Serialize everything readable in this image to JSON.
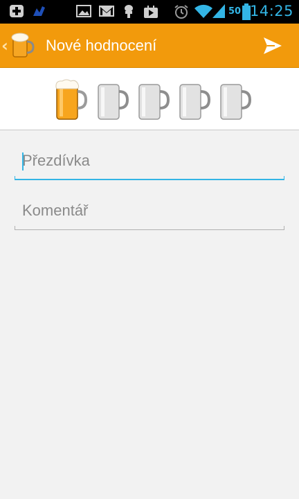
{
  "status_bar": {
    "time": "14:25",
    "battery_level": "50",
    "icons": [
      "add-notification-icon",
      "app-notification-icon",
      "image-icon",
      "gmail-icon",
      "usb-debug-icon",
      "play-store-icon",
      "alarm-icon",
      "wifi-icon",
      "signal-icon",
      "battery-icon"
    ]
  },
  "action_bar": {
    "title": "Nové hodnocení",
    "app_icon": "beer-mug-icon",
    "action_icon": "send-icon"
  },
  "rating": {
    "value": 1,
    "max": 5
  },
  "form": {
    "nickname_placeholder": "Přezdívka",
    "nickname_value": "",
    "comment_placeholder": "Komentář",
    "comment_value": ""
  },
  "colors": {
    "action_bar": "#f29a0c",
    "accent": "#33b5e5",
    "background": "#f2f2f2"
  }
}
